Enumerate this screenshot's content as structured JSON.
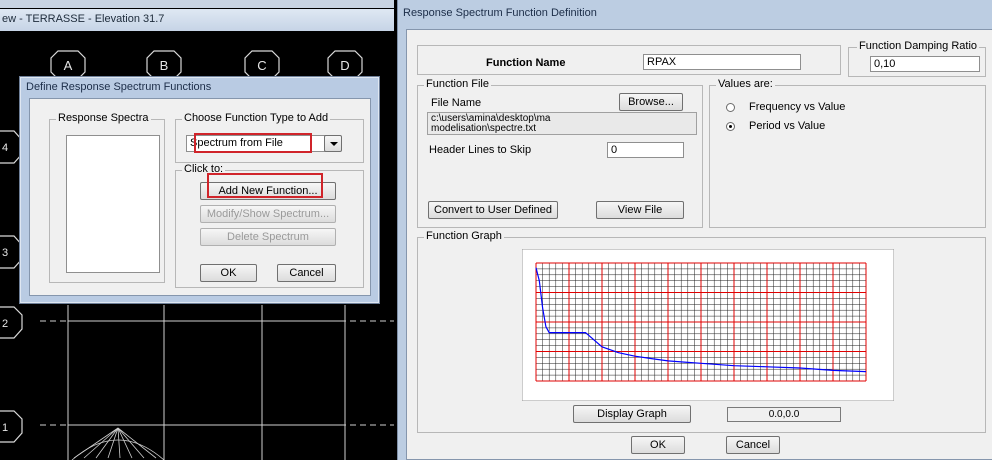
{
  "elevation_view": {
    "title": "ew - TERRASSE - Elevation 31.7",
    "grid_bubbles": [
      "A",
      "B",
      "C",
      "D"
    ],
    "story_labels": [
      "4",
      "3",
      "2",
      "1"
    ]
  },
  "define_dialog": {
    "title": "Define Response Spectrum Functions",
    "response_spectra_label": "Response Spectra",
    "choose_type_label": "Choose  Function Type to Add",
    "function_type_selected": "Spectrum from File",
    "click_to_label": "Click to:",
    "add_new_function": "Add New Function...",
    "modify_show_spectrum": "Modify/Show Spectrum...",
    "delete_spectrum": "Delete Spectrum",
    "ok": "OK",
    "cancel": "Cancel"
  },
  "function_definition": {
    "title": "Response Spectrum  Function Definition",
    "function_name_label": "Function Name",
    "function_name_value": "RPAX",
    "damping_label": "Function Damping Ratio",
    "damping_value": "0,10",
    "function_file_label": "Function File",
    "file_name_label": "File Name",
    "browse": "Browse...",
    "file_path_line1": "c:\\users\\amina\\desktop\\ma",
    "file_path_line2": "modelisation\\spectre.txt",
    "header_lines_label": "Header Lines to Skip",
    "header_lines_value": "0",
    "convert_button": "Convert to User Defined",
    "view_file_button": "View File",
    "values_are_label": "Values are:",
    "radio_frequency": "Frequency vs Value",
    "radio_period": "Period vs Value",
    "selected_radio": "period",
    "function_graph_label": "Function Graph",
    "display_graph_button": "Display Graph",
    "coordinate_readout": "0.0,0.0",
    "ok": "OK",
    "cancel": "Cancel"
  },
  "colors": {
    "highlight": "#d0242a",
    "graph_major_grid": "#e00000",
    "graph_minor_grid": "#202020",
    "curve": "#0000ff"
  },
  "chart_data": {
    "type": "line",
    "title": "",
    "xlabel": "",
    "ylabel": "",
    "grid": true,
    "x": [
      0.0,
      0.01,
      0.02,
      0.03,
      0.04,
      0.05,
      0.1,
      0.15,
      0.2,
      0.25,
      0.3,
      0.35,
      0.4,
      0.45,
      0.5,
      0.6,
      0.7,
      0.8,
      0.9,
      1.0
    ],
    "series": [
      {
        "values": [
          0.96,
          0.85,
          0.62,
          0.46,
          0.41,
          0.41,
          0.41,
          0.41,
          0.29,
          0.24,
          0.21,
          0.19,
          0.17,
          0.16,
          0.15,
          0.13,
          0.12,
          0.11,
          0.09,
          0.08
        ]
      }
    ]
  }
}
